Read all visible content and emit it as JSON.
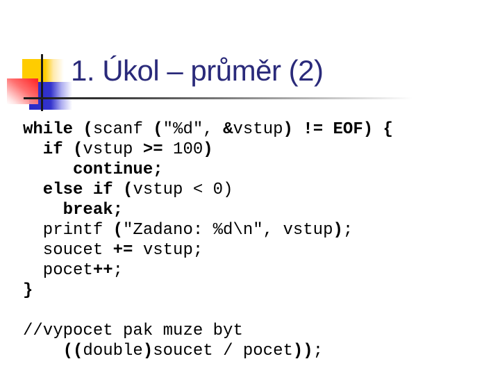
{
  "slide": {
    "title": "1. Úkol – průměr (2)",
    "colors": {
      "title": "#2a2a7a",
      "accent_yellow": "#ffcc00",
      "accent_red": "#ff2020",
      "accent_blue": "#3333cc",
      "rule": "#1a1a1a"
    }
  },
  "code": {
    "lines": [
      [
        {
          "t": "while (",
          "b": true
        },
        {
          "t": "scanf ",
          "b": false
        },
        {
          "t": "(",
          "b": true
        },
        {
          "t": "\"%d\", ",
          "b": false
        },
        {
          "t": "&",
          "b": true
        },
        {
          "t": "vstup",
          "b": false
        },
        {
          "t": ") != EOF) {",
          "b": true
        }
      ],
      [
        {
          "t": "  if (",
          "b": true
        },
        {
          "t": "vstup ",
          "b": false
        },
        {
          "t": ">=",
          "b": true
        },
        {
          "t": " 100",
          "b": false
        },
        {
          "t": ")",
          "b": true
        }
      ],
      [
        {
          "t": "     continue;",
          "b": true
        }
      ],
      [
        {
          "t": "  else if (",
          "b": true
        },
        {
          "t": "vstup ",
          "b": false
        },
        {
          "t": "<",
          "b": false
        },
        {
          "t": " 0)",
          "b": false
        }
      ],
      [
        {
          "t": "    break;",
          "b": true
        }
      ],
      [
        {
          "t": "  printf ",
          "b": false
        },
        {
          "t": "(",
          "b": true
        },
        {
          "t": "\"Zadano: %d\\n\", vstup",
          "b": false
        },
        {
          "t": ")",
          "b": true
        },
        {
          "t": ";",
          "b": false
        }
      ],
      [
        {
          "t": "  soucet ",
          "b": false
        },
        {
          "t": "+=",
          "b": true
        },
        {
          "t": " vstup;",
          "b": false
        }
      ],
      [
        {
          "t": "  pocet",
          "b": false
        },
        {
          "t": "++",
          "b": true
        },
        {
          "t": ";",
          "b": false
        }
      ],
      [
        {
          "t": "}",
          "b": true
        }
      ],
      [],
      [
        {
          "t": "//vypocet pak muze byt",
          "b": false
        }
      ],
      [
        {
          "t": "    ((",
          "b": true
        },
        {
          "t": "double",
          "b": false
        },
        {
          "t": ")",
          "b": true
        },
        {
          "t": "soucet / pocet",
          "b": false
        },
        {
          "t": "))",
          "b": true
        },
        {
          "t": ";",
          "b": false
        }
      ]
    ]
  }
}
